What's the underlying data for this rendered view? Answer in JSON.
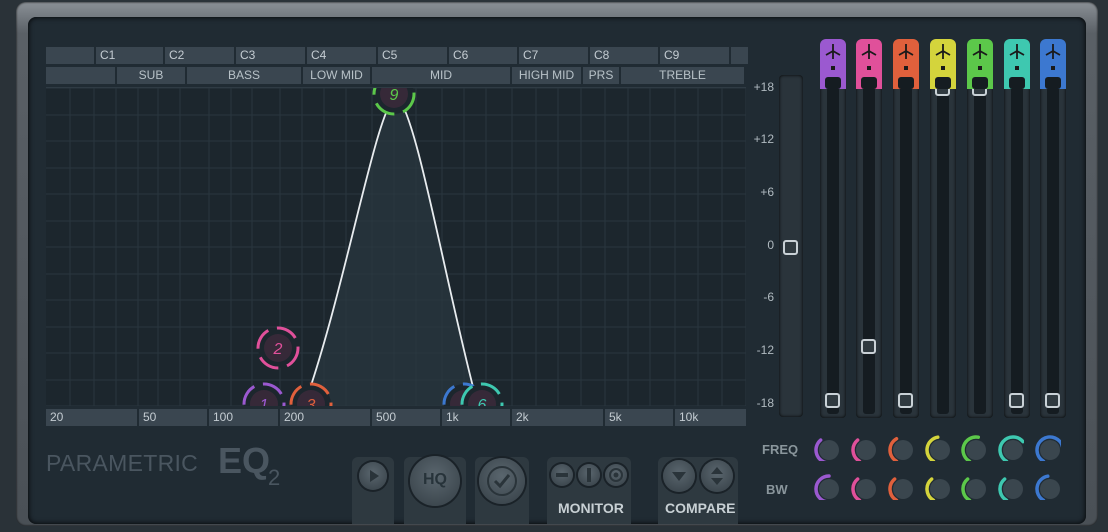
{
  "app": {
    "title_left": "PARAMETRIC",
    "title_main": "EQ",
    "title_sub": "2"
  },
  "octave_row": [
    "",
    "C1",
    "C2",
    "C3",
    "C4",
    "C5",
    "C6",
    "C7",
    "C8",
    "C9",
    ""
  ],
  "band_row": [
    "",
    "SUB",
    "BASS",
    "LOW MID",
    "MID",
    "HIGH MID",
    "PRS",
    "TREBLE"
  ],
  "db_scale": [
    "+18",
    "+12",
    "+6",
    "0",
    "-6",
    "-12",
    "-18"
  ],
  "freq_scale": [
    "20",
    "50",
    "100",
    "200",
    "500",
    "1k",
    "2k",
    "5k",
    "10k"
  ],
  "bands": [
    {
      "id": "1",
      "color": "#9b59d0",
      "level_pct": 2
    },
    {
      "id": "2",
      "color": "#e0509a",
      "level_pct": 19
    },
    {
      "id": "3",
      "color": "#e0603c",
      "level_pct": 2
    },
    {
      "id": "4",
      "color": "#d4d43c",
      "level_pct": 100
    },
    {
      "id": "5",
      "color": "#5cc84a",
      "level_pct": 100
    },
    {
      "id": "6",
      "color": "#3ec8b0",
      "level_pct": 2
    },
    {
      "id": "7",
      "color": "#3c78d0",
      "level_pct": 2
    }
  ],
  "curve_nodes": [
    {
      "label": "1",
      "color": "#9b59d0"
    },
    {
      "label": "2",
      "color": "#e0509a"
    },
    {
      "label": "3",
      "color": "#e0603c"
    },
    {
      "label": "9",
      "color": "#5cc84a"
    },
    {
      "label": "7",
      "color": "#3c78d0"
    },
    {
      "label": "6",
      "color": "#3ec8b0"
    }
  ],
  "main_level_db": 0,
  "knob_rows": {
    "freq_label": "FREQ",
    "bw_label": "BW"
  },
  "buttons": {
    "hq": "HQ",
    "monitor": "MONITOR",
    "compare": "COMPARE"
  },
  "colors": {
    "accent_green": "#5cc84a",
    "curve": "#e8ecef",
    "panel": "#202b33"
  }
}
